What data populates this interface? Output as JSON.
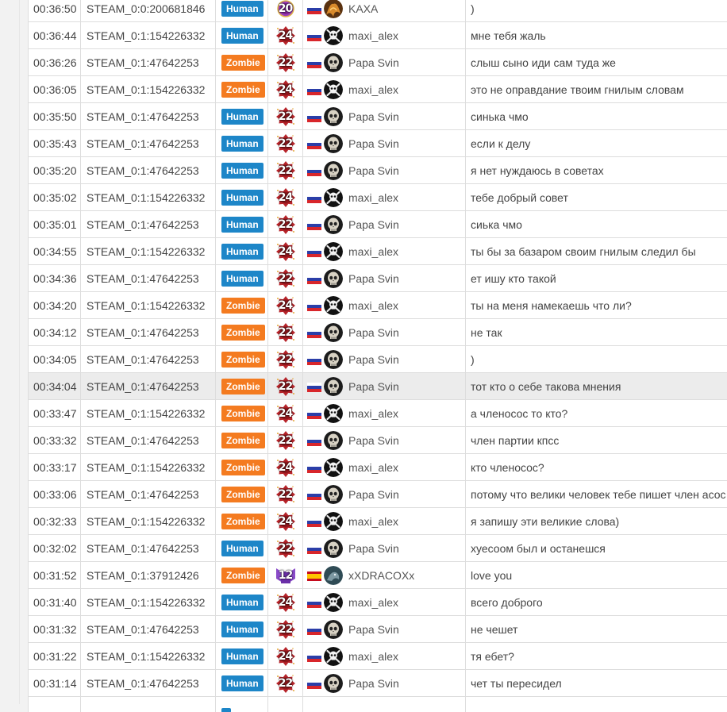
{
  "colors": {
    "human": "#1d86c8",
    "zombie": "#f47b20",
    "flag_ru": [
      "#ffffff",
      "#2b3ea8",
      "#d8262b"
    ],
    "flag_es": [
      "#c60b1e",
      "#ffc400",
      "#c60b1e"
    ]
  },
  "rows": [
    {
      "time": "00:36:50",
      "steam": "STEAM_0:0:200681846",
      "team": "Human",
      "rank": "20",
      "rank_icon": "purple-rank-icon",
      "flag": "ru",
      "avatar": "kaxa-avatar",
      "player": "KAXA",
      "message": ")"
    },
    {
      "time": "00:36:44",
      "steam": "STEAM_0:1:154226332",
      "team": "Human",
      "rank": "24",
      "rank_icon": "red-splat-rank-icon",
      "flag": "ru",
      "avatar": "skull-crossbones-avatar",
      "player": "maxi_alex",
      "message": "мне тебя жаль"
    },
    {
      "time": "00:36:26",
      "steam": "STEAM_0:1:47642253",
      "team": "Zombie",
      "rank": "22",
      "rank_icon": "red-splat-rank-icon",
      "flag": "ru",
      "avatar": "skull-avatar",
      "player": "Papa Svin",
      "message": "слыш сыно иди сам туда же"
    },
    {
      "time": "00:36:05",
      "steam": "STEAM_0:1:154226332",
      "team": "Zombie",
      "rank": "24",
      "rank_icon": "red-splat-rank-icon",
      "flag": "ru",
      "avatar": "skull-crossbones-avatar",
      "player": "maxi_alex",
      "message": "это не оправдание твоим гнилым словам"
    },
    {
      "time": "00:35:50",
      "steam": "STEAM_0:1:47642253",
      "team": "Human",
      "rank": "22",
      "rank_icon": "red-splat-rank-icon",
      "flag": "ru",
      "avatar": "skull-avatar",
      "player": "Papa Svin",
      "message": "синька чмо"
    },
    {
      "time": "00:35:43",
      "steam": "STEAM_0:1:47642253",
      "team": "Human",
      "rank": "22",
      "rank_icon": "red-splat-rank-icon",
      "flag": "ru",
      "avatar": "skull-avatar",
      "player": "Papa Svin",
      "message": "если к делу"
    },
    {
      "time": "00:35:20",
      "steam": "STEAM_0:1:47642253",
      "team": "Human",
      "rank": "22",
      "rank_icon": "red-splat-rank-icon",
      "flag": "ru",
      "avatar": "skull-avatar",
      "player": "Papa Svin",
      "message": "я нет нуждаюсь в советах"
    },
    {
      "time": "00:35:02",
      "steam": "STEAM_0:1:154226332",
      "team": "Human",
      "rank": "24",
      "rank_icon": "red-splat-rank-icon",
      "flag": "ru",
      "avatar": "skull-crossbones-avatar",
      "player": "maxi_alex",
      "message": "тебе добрый совет"
    },
    {
      "time": "00:35:01",
      "steam": "STEAM_0:1:47642253",
      "team": "Human",
      "rank": "22",
      "rank_icon": "red-splat-rank-icon",
      "flag": "ru",
      "avatar": "skull-avatar",
      "player": "Papa Svin",
      "message": "сиька чмо"
    },
    {
      "time": "00:34:55",
      "steam": "STEAM_0:1:154226332",
      "team": "Human",
      "rank": "24",
      "rank_icon": "red-splat-rank-icon",
      "flag": "ru",
      "avatar": "skull-crossbones-avatar",
      "player": "maxi_alex",
      "message": "ты бы за базаром своим гнилым следил бы"
    },
    {
      "time": "00:34:36",
      "steam": "STEAM_0:1:47642253",
      "team": "Human",
      "rank": "22",
      "rank_icon": "red-splat-rank-icon",
      "flag": "ru",
      "avatar": "skull-avatar",
      "player": "Papa Svin",
      "message": "ет ишу кто такой"
    },
    {
      "time": "00:34:20",
      "steam": "STEAM_0:1:154226332",
      "team": "Zombie",
      "rank": "24",
      "rank_icon": "red-splat-rank-icon",
      "flag": "ru",
      "avatar": "skull-crossbones-avatar",
      "player": "maxi_alex",
      "message": "ты на меня намекаешь что ли?"
    },
    {
      "time": "00:34:12",
      "steam": "STEAM_0:1:47642253",
      "team": "Zombie",
      "rank": "22",
      "rank_icon": "red-splat-rank-icon",
      "flag": "ru",
      "avatar": "skull-avatar",
      "player": "Papa Svin",
      "message": "не так"
    },
    {
      "time": "00:34:05",
      "steam": "STEAM_0:1:47642253",
      "team": "Zombie",
      "rank": "22",
      "rank_icon": "red-splat-rank-icon",
      "flag": "ru",
      "avatar": "skull-avatar",
      "player": "Papa Svin",
      "message": ")"
    },
    {
      "time": "00:34:04",
      "steam": "STEAM_0:1:47642253",
      "team": "Zombie",
      "rank": "22",
      "rank_icon": "red-splat-rank-icon",
      "flag": "ru",
      "avatar": "skull-avatar",
      "player": "Papa Svin",
      "message": "тот кто о себе такова мнения",
      "highlight": true
    },
    {
      "time": "00:33:47",
      "steam": "STEAM_0:1:154226332",
      "team": "Zombie",
      "rank": "24",
      "rank_icon": "red-splat-rank-icon",
      "flag": "ru",
      "avatar": "skull-crossbones-avatar",
      "player": "maxi_alex",
      "message": "а членосос то кто?"
    },
    {
      "time": "00:33:32",
      "steam": "STEAM_0:1:47642253",
      "team": "Zombie",
      "rank": "22",
      "rank_icon": "red-splat-rank-icon",
      "flag": "ru",
      "avatar": "skull-avatar",
      "player": "Papa Svin",
      "message": "член партии кпсс"
    },
    {
      "time": "00:33:17",
      "steam": "STEAM_0:1:154226332",
      "team": "Zombie",
      "rank": "24",
      "rank_icon": "red-splat-rank-icon",
      "flag": "ru",
      "avatar": "skull-crossbones-avatar",
      "player": "maxi_alex",
      "message": "кто членосос?"
    },
    {
      "time": "00:33:06",
      "steam": "STEAM_0:1:47642253",
      "team": "Zombie",
      "rank": "22",
      "rank_icon": "red-splat-rank-icon",
      "flag": "ru",
      "avatar": "skull-avatar",
      "player": "Papa Svin",
      "message": "потому что велики человек тебе пишет член асос"
    },
    {
      "time": "00:32:33",
      "steam": "STEAM_0:1:154226332",
      "team": "Zombie",
      "rank": "24",
      "rank_icon": "red-splat-rank-icon",
      "flag": "ru",
      "avatar": "skull-crossbones-avatar",
      "player": "maxi_alex",
      "message": "я запишу эти великие слова)"
    },
    {
      "time": "00:32:02",
      "steam": "STEAM_0:1:47642253",
      "team": "Human",
      "rank": "22",
      "rank_icon": "red-splat-rank-icon",
      "flag": "ru",
      "avatar": "skull-avatar",
      "player": "Papa Svin",
      "message": "хуесоом был и останешся"
    },
    {
      "time": "00:31:52",
      "steam": "STEAM_0:1:37912426",
      "team": "Zombie",
      "rank": "12",
      "rank_icon": "purple-wings-rank-icon",
      "flag": "es",
      "avatar": "dragon-avatar",
      "player": "xXDRACOXx",
      "message": "love you"
    },
    {
      "time": "00:31:40",
      "steam": "STEAM_0:1:154226332",
      "team": "Human",
      "rank": "24",
      "rank_icon": "red-splat-rank-icon",
      "flag": "ru",
      "avatar": "skull-crossbones-avatar",
      "player": "maxi_alex",
      "message": "всего доброго"
    },
    {
      "time": "00:31:32",
      "steam": "STEAM_0:1:47642253",
      "team": "Human",
      "rank": "22",
      "rank_icon": "red-splat-rank-icon",
      "flag": "ru",
      "avatar": "skull-avatar",
      "player": "Papa Svin",
      "message": "не чешет"
    },
    {
      "time": "00:31:22",
      "steam": "STEAM_0:1:154226332",
      "team": "Human",
      "rank": "24",
      "rank_icon": "red-splat-rank-icon",
      "flag": "ru",
      "avatar": "skull-crossbones-avatar",
      "player": "maxi_alex",
      "message": "тя ебет?"
    },
    {
      "time": "00:31:14",
      "steam": "STEAM_0:1:47642253",
      "team": "Human",
      "rank": "22",
      "rank_icon": "red-splat-rank-icon",
      "flag": "ru",
      "avatar": "skull-avatar",
      "player": "Papa Svin",
      "message": "чет ты пересидел"
    }
  ]
}
